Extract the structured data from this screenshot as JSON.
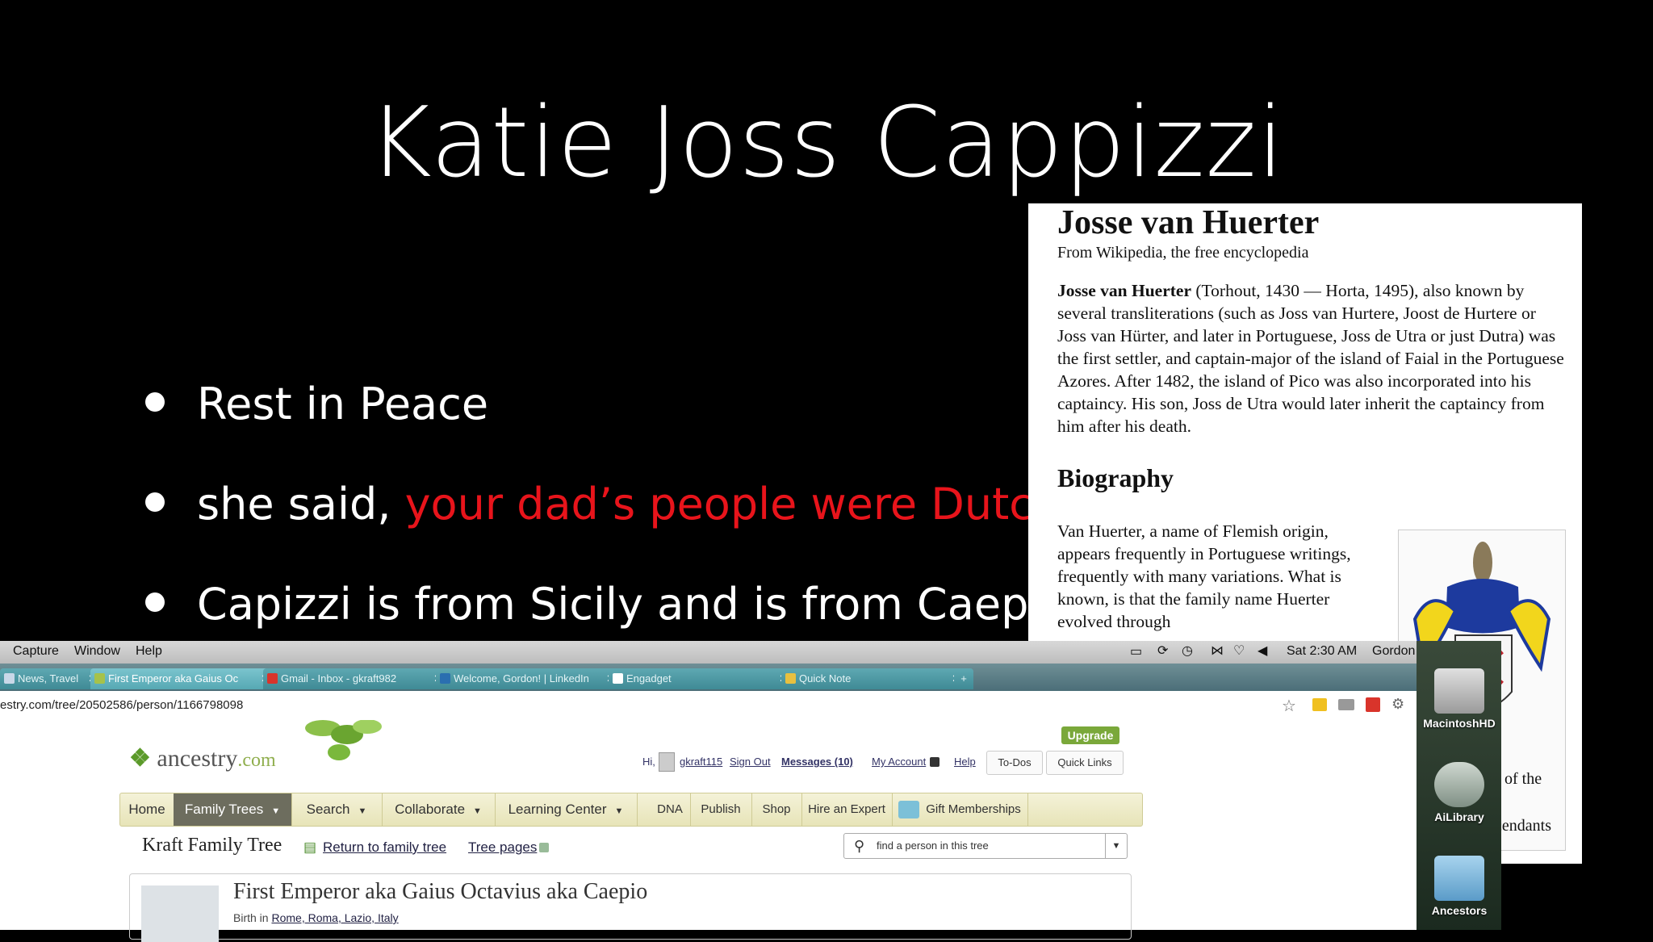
{
  "slide": {
    "title": "Katie Joss Cappizzi",
    "bullets": [
      {
        "text": "Rest in Peace",
        "red": ""
      },
      {
        "text": "she said, ",
        "red": "your dad’s people were Dutch..."
      },
      {
        "text": "Capizzi is from Sicily and is from Caepio...",
        "red": ""
      }
    ]
  },
  "wiki": {
    "title": "Josse van Huerter",
    "subtitle": "From Wikipedia, the free encyclopedia",
    "name_bold": "Josse van Huerter",
    "para": " (Torhout, 1430 — Horta, 1495), also known by several transliterations (such as Joss van Hurtere, Joost de Hurtere or Joss van Hürter, and later in Portuguese, Joss de Utra or just Dutra) was the first settler, and captain-major of the island of Faial in the Portuguese Azores. After 1482, the island of Pico was also incorporated into his captaincy. His son, Joss de Utra would later inherit the captaincy from him after his death.",
    "bio_heading": "Biography",
    "bio_text": "Van Huerter, a name of Flemish origin, appears frequently in Portuguese writings, frequently with many variations. What is known, is that the family name Huerter evolved through",
    "right_fragment_1": "of the",
    "right_fragment_2": "cendants"
  },
  "menubar": {
    "items": [
      "Capture",
      "Window",
      "Help"
    ],
    "clock": "Sat 2:30 AM",
    "user": "Gordon Kraft"
  },
  "tabs": [
    {
      "label": "News, Travel",
      "color": "#c9d8e8"
    },
    {
      "label": "First Emperor aka Gaius Oc",
      "color": "#a6c24a"
    },
    {
      "label": "Gmail - Inbox - gkraft982",
      "color": "#d9342b"
    },
    {
      "label": "Welcome, Gordon! | LinkedIn",
      "color": "#2a6fb0"
    },
    {
      "label": "Engadget",
      "color": "#ffffff"
    },
    {
      "label": "Quick Note",
      "color": "#e8c040"
    }
  ],
  "url": "estry.com/tree/20502586/person/1166798098",
  "dock": [
    {
      "label": "MacintoshHD"
    },
    {
      "label": "AiLibrary"
    },
    {
      "label": "Ancestors"
    }
  ],
  "ancestry": {
    "logo_main": "ancestry",
    "logo_domain": ".com",
    "upgrade": "Upgrade",
    "hi": "Hi,",
    "username": "gkraft115",
    "sign_out": "Sign Out",
    "messages": "Messages (10)",
    "my_account": "My Account",
    "help": "Help",
    "todos": "To-Dos",
    "quick_links": "Quick Links",
    "nav": [
      "Home",
      "Family Trees",
      "Search",
      "Collaborate",
      "Learning Center",
      "DNA",
      "Publish",
      "Shop",
      "Hire an Expert",
      "Gift Memberships"
    ],
    "tree_title": "Kraft Family Tree",
    "return_link": "Return to family tree",
    "tree_pages": "Tree pages",
    "find_placeholder": "find a person in this tree",
    "person_name": "First Emperor aka Gaius Octavius aka Caepio",
    "birth_label": "Birth in",
    "birth_place": "Rome, Roma, Lazio, Italy"
  }
}
